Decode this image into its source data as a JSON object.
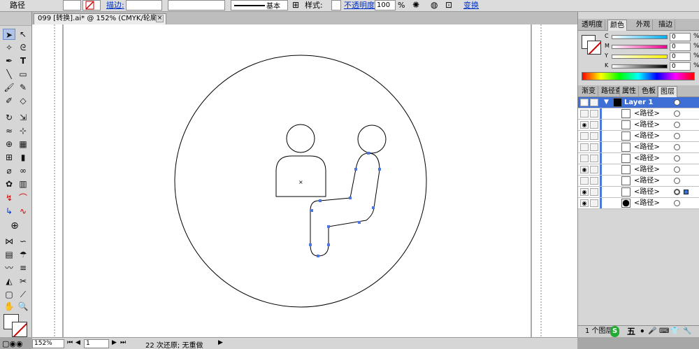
{
  "control_bar": {
    "object_type": "路径",
    "stroke_link": "描边:",
    "stroke_weight": "",
    "brush_label": "基本",
    "style_label": "样式:",
    "opacity_link": "不透明度:",
    "opacity_value": "100",
    "opacity_unit": "%",
    "transform_link": "变换"
  },
  "document_tab": {
    "title": "099 [转换].ai* @ 152% (CMYK/轮廓)",
    "close": "×"
  },
  "tools": {
    "items": [
      "selection-tool",
      "direct-selection-tool",
      "magic-wand-tool",
      "lasso-tool",
      "pen-tool",
      "type-tool",
      "line-tool",
      "rectangle-tool",
      "paintbrush-tool",
      "pencil-tool",
      "blob-brush-tool",
      "eraser-tool",
      "rotate-tool",
      "scale-tool",
      "warp-tool",
      "free-transform-tool",
      "shape-builder-tool",
      "perspective-grid-tool",
      "mesh-tool",
      "gradient-tool",
      "eyedropper-tool",
      "blend-tool",
      "symbol-sprayer-tool",
      "column-graph-tool",
      "artboard-tool",
      "slice-tool",
      "hand-tool",
      "zoom-tool"
    ]
  },
  "status_bar": {
    "zoom": "152%",
    "artboard": "1",
    "history": "22 次还原; 无重做"
  },
  "color_panel": {
    "tabs": [
      "透明度",
      "颜色",
      "外观",
      "描边"
    ],
    "active_tab": "颜色",
    "channels": [
      {
        "label": "C",
        "value": "0",
        "unit": "%",
        "color": "#00aeef"
      },
      {
        "label": "M",
        "value": "0",
        "unit": "%",
        "color": "#ec008c"
      },
      {
        "label": "Y",
        "value": "0",
        "unit": "%",
        "color": "#fff200"
      },
      {
        "label": "K",
        "value": "0",
        "unit": "%",
        "color": "#000000"
      }
    ]
  },
  "layers_panel": {
    "tabs": [
      "渐变",
      "路径查",
      "属性",
      "色板",
      "图层"
    ],
    "active_tab": "图层",
    "layer_name": "Layer 1",
    "items": [
      {
        "name": "<路径>",
        "visible": false
      },
      {
        "name": "<路径>",
        "visible": true
      },
      {
        "name": "<路径>",
        "visible": false
      },
      {
        "name": "<路径>",
        "visible": false
      },
      {
        "name": "<路径>",
        "visible": false
      },
      {
        "name": "<路径>",
        "visible": true
      },
      {
        "name": "<路径>",
        "visible": false
      },
      {
        "name": "<路径>",
        "visible": true
      },
      {
        "name": "<路径>",
        "visible": true
      }
    ],
    "footer": "1 个图层"
  },
  "ime_bar": {
    "items": [
      "五",
      "•",
      "🎤",
      "⌨",
      "👕",
      "🔧"
    ]
  },
  "accent": "#3d6fd6"
}
